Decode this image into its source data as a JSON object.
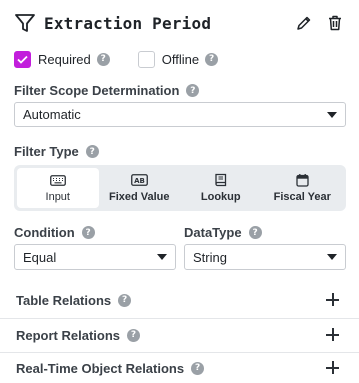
{
  "header": {
    "title": "Extraction Period",
    "icons": {
      "filter": "filter-icon",
      "edit": "pencil-icon",
      "delete": "trash-icon"
    }
  },
  "options": {
    "required": {
      "label": "Required",
      "checked": true
    },
    "offline": {
      "label": "Offline",
      "checked": false
    }
  },
  "scope": {
    "label": "Filter Scope Determination",
    "value": "Automatic"
  },
  "filter_type": {
    "label": "Filter Type",
    "options": [
      {
        "label": "Input",
        "icon": "keyboard-icon",
        "active": true
      },
      {
        "label": "Fixed Value",
        "icon": "ab-icon",
        "active": false
      },
      {
        "label": "Lookup",
        "icon": "book-icon",
        "active": false
      },
      {
        "label": "Fiscal Year",
        "icon": "calendar-icon",
        "active": false
      }
    ]
  },
  "condition": {
    "label": "Condition",
    "value": "Equal"
  },
  "datatype": {
    "label": "DataType",
    "value": "String"
  },
  "sections": [
    {
      "label": "Table Relations"
    },
    {
      "label": "Report Relations"
    },
    {
      "label": "Real-Time Object Relations"
    }
  ],
  "colors": {
    "accent": "#c21edc",
    "segment_bg": "#e9ecef",
    "help_icon": "#9aa0a6"
  }
}
